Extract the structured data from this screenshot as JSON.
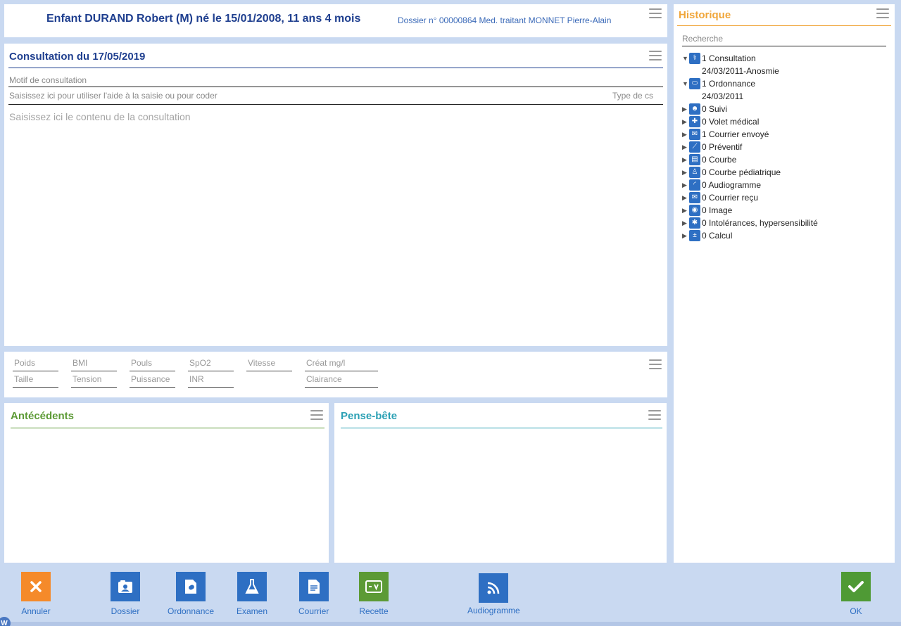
{
  "header": {
    "title": "Enfant DURAND Robert (M) né le 15/01/2008, 11 ans 4 mois",
    "meta": "Dossier n° 00000864 Med. traitant MONNET Pierre-Alain"
  },
  "consultation": {
    "title": "Consultation du  17/05/2019",
    "motif_label": "Motif de consultation",
    "aide_placeholder": "Saisissez ici pour utiliser l'aide à la saisie ou pour coder",
    "type_label": "Type de cs",
    "content_placeholder": "Saisissez ici le contenu de la consultation"
  },
  "measures": {
    "row1": [
      "Poids",
      "BMI",
      "Pouls",
      "SpO2",
      "Vitesse",
      "Créat mg/l"
    ],
    "row2": [
      "Taille",
      "Tension",
      "Puissance",
      "INR",
      "Clairance"
    ]
  },
  "antecedents": {
    "title": "Antécédents"
  },
  "pense_bete": {
    "title": "Pense-bête"
  },
  "history": {
    "title": "Historique",
    "search_placeholder": "Recherche",
    "items": [
      {
        "label": "1 Consultation",
        "icon": "stethoscope-icon",
        "expanded": true,
        "sub": "24/03/2011-Anosmie"
      },
      {
        "label": "1 Ordonnance",
        "icon": "pill-icon",
        "expanded": true,
        "sub": "24/03/2011"
      },
      {
        "label": "0 Suivi",
        "icon": "suivi-icon",
        "expanded": false
      },
      {
        "label": "0 Volet médical",
        "icon": "volet-medical-icon",
        "expanded": false
      },
      {
        "label": "1 Courrier envoyé",
        "icon": "mail-sent-icon",
        "expanded": false
      },
      {
        "label": "0 Préventif",
        "icon": "syringe-icon",
        "expanded": false
      },
      {
        "label": "0 Courbe",
        "icon": "chart-icon",
        "expanded": false
      },
      {
        "label": "0 Courbe pédiatrique",
        "icon": "child-icon",
        "expanded": false
      },
      {
        "label": "0 Audiogramme",
        "icon": "audio-icon",
        "expanded": false
      },
      {
        "label": "0 Courrier reçu",
        "icon": "mail-received-icon",
        "expanded": false
      },
      {
        "label": "0 Image",
        "icon": "camera-icon",
        "expanded": false
      },
      {
        "label": "0 Intolérances, hypersensibilité",
        "icon": "allergy-icon",
        "expanded": false
      },
      {
        "label": "0 Calcul",
        "icon": "calculator-icon",
        "expanded": false
      }
    ]
  },
  "actions": {
    "annuler": "Annuler",
    "dossier": "Dossier",
    "ordonnance": "Ordonnance",
    "examen": "Examen",
    "courrier": "Courrier",
    "recette": "Recette",
    "audiogramme": "Audiogramme",
    "ok": "OK"
  },
  "colors": {
    "primary_blue": "#1f3f8f",
    "accent_blue": "#2e6fc3",
    "antecedents_green": "#5c9a35",
    "pense_bete_teal": "#2aa0b4",
    "history_orange": "#f0a63a",
    "annuler_orange": "#f58a2a",
    "recette_green": "#5c9a35",
    "ok_green": "#4f9a35"
  }
}
